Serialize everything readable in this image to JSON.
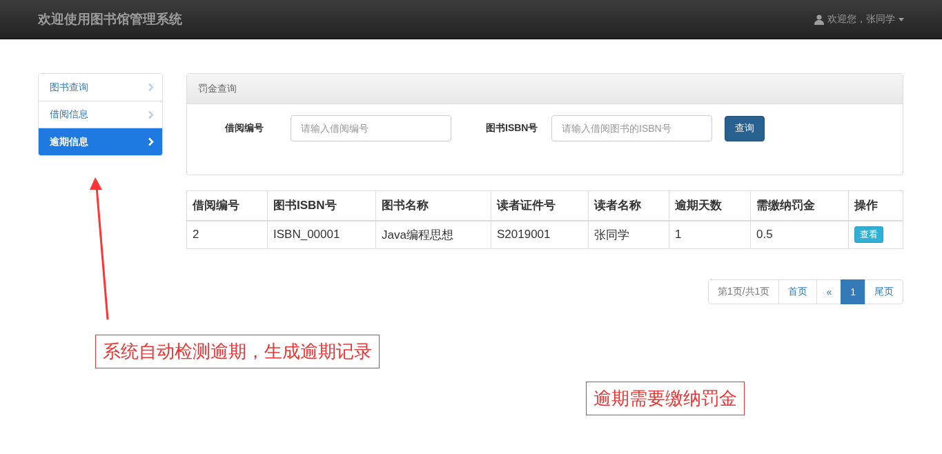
{
  "navbar": {
    "brand": "欢迎使用图书馆管理系统",
    "user": "欢迎您，张同学"
  },
  "sidebar": {
    "items": [
      {
        "label": "图书查询",
        "selected": false
      },
      {
        "label": "借阅信息",
        "selected": false
      },
      {
        "label": "逾期信息",
        "selected": true
      }
    ]
  },
  "panel": {
    "title": "罚金查询",
    "fields": [
      {
        "label": "借阅编号",
        "placeholder": "请输入借阅编号"
      },
      {
        "label": "图书ISBN号",
        "placeholder": "请输入借阅图书的ISBN号"
      }
    ],
    "button": "查询"
  },
  "table": {
    "columns": [
      "借阅编号",
      "图书ISBN号",
      "图书名称",
      "读者证件号",
      "读者名称",
      "逾期天数",
      "需缴纳罚金",
      "操作"
    ],
    "rows": [
      {
        "cells": [
          "2",
          "ISBN_00001",
          "Java编程思想",
          "S2019001",
          "张同学",
          "1",
          "0.5"
        ],
        "action": "查看"
      }
    ]
  },
  "pagination": {
    "info": "第1页/共1页",
    "first": "首页",
    "prev": "«",
    "pages": [
      {
        "label": "1",
        "selected": true
      }
    ],
    "last": "尾页"
  },
  "annotations": [
    "系统自动检测逾期，生成逾期记录",
    "逾期需要缴纳罚金"
  ]
}
